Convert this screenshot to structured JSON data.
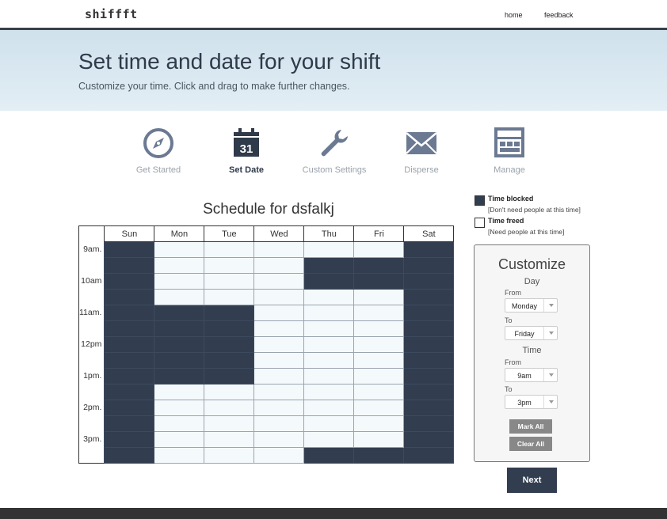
{
  "app": {
    "logo": "shiffft"
  },
  "nav": {
    "home": "home",
    "feedback": "feedback"
  },
  "hero": {
    "title": "Set time and date for your shift",
    "subtitle": "Customize your time. Click and drag to make further changes."
  },
  "steps": [
    {
      "label": "Get Started",
      "icon": "compass-icon",
      "active": false
    },
    {
      "label": "Set Date",
      "icon": "calendar-icon",
      "active": true,
      "calendar_day": "31"
    },
    {
      "label": "Custom Settings",
      "icon": "wrench-icon",
      "active": false
    },
    {
      "label": "Disperse",
      "icon": "envelope-icon",
      "active": false
    },
    {
      "label": "Manage",
      "icon": "layout-icon",
      "active": false
    }
  ],
  "schedule": {
    "title": "Schedule for dsfalkj",
    "days": [
      "Sun",
      "Mon",
      "Tue",
      "Wed",
      "Thu",
      "Fri",
      "Sat"
    ],
    "time_labels": [
      "9am.",
      "10am",
      "11am.",
      "12pm",
      "1pm.",
      "2pm.",
      "3pm."
    ],
    "blocked_rows": [
      [
        1,
        0,
        0,
        0,
        0,
        0,
        1
      ],
      [
        1,
        0,
        0,
        0,
        1,
        1,
        1
      ],
      [
        1,
        0,
        0,
        0,
        1,
        1,
        1
      ],
      [
        1,
        0,
        0,
        0,
        0,
        0,
        1
      ],
      [
        1,
        1,
        1,
        0,
        0,
        0,
        1
      ],
      [
        1,
        1,
        1,
        0,
        0,
        0,
        1
      ],
      [
        1,
        1,
        1,
        0,
        0,
        0,
        1
      ],
      [
        1,
        1,
        1,
        0,
        0,
        0,
        1
      ],
      [
        1,
        1,
        1,
        0,
        0,
        0,
        1
      ],
      [
        1,
        0,
        0,
        0,
        0,
        0,
        1
      ],
      [
        1,
        0,
        0,
        0,
        0,
        0,
        1
      ],
      [
        1,
        0,
        0,
        0,
        0,
        0,
        1
      ],
      [
        1,
        0,
        0,
        0,
        0,
        0,
        1
      ],
      [
        1,
        0,
        0,
        0,
        1,
        1,
        1
      ]
    ],
    "colors": {
      "blocked": "#323d50",
      "freed": "#f4fafc"
    }
  },
  "legend": {
    "blocked_title": "Time blocked",
    "blocked_note": "[Don't need people at this time]",
    "freed_title": "Time freed",
    "freed_note": "[Need people at this time]"
  },
  "customize": {
    "title": "Customize",
    "day_heading": "Day",
    "day_from_label": "From",
    "day_from": "Monday",
    "day_to_label": "To",
    "day_to": "Friday",
    "time_heading": "Time",
    "time_from_label": "From",
    "time_from": "9am",
    "time_to_label": "To",
    "time_to": "3pm",
    "mark_all": "Mark All",
    "clear_all": "Clear All"
  },
  "next_label": "Next"
}
